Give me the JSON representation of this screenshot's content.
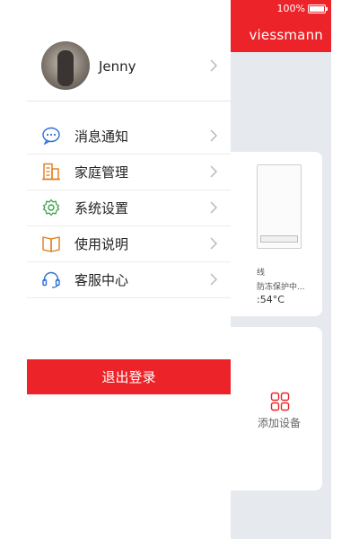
{
  "status_bar": {
    "battery": "100%"
  },
  "background_app": {
    "brand": "viessmann",
    "device_card": {
      "status": "线",
      "mode": "防冻保护中...",
      "temperature": ":54°C"
    },
    "add_device": {
      "label": "添加设备"
    }
  },
  "drawer": {
    "user": {
      "name": "Jenny"
    },
    "menu": [
      {
        "label": "消息通知",
        "icon": "message-bubble-icon"
      },
      {
        "label": "家庭管理",
        "icon": "home-management-icon"
      },
      {
        "label": "系统设置",
        "icon": "settings-gear-icon"
      },
      {
        "label": "使用说明",
        "icon": "book-icon"
      },
      {
        "label": "客服中心",
        "icon": "headset-icon"
      }
    ],
    "logout_label": "退出登录"
  },
  "colors": {
    "accent": "#ec2328",
    "background": "#e6e9ee",
    "blue_icon": "#2f6fd6",
    "orange_icon": "#e07b1a",
    "green_icon": "#3aa34a"
  }
}
